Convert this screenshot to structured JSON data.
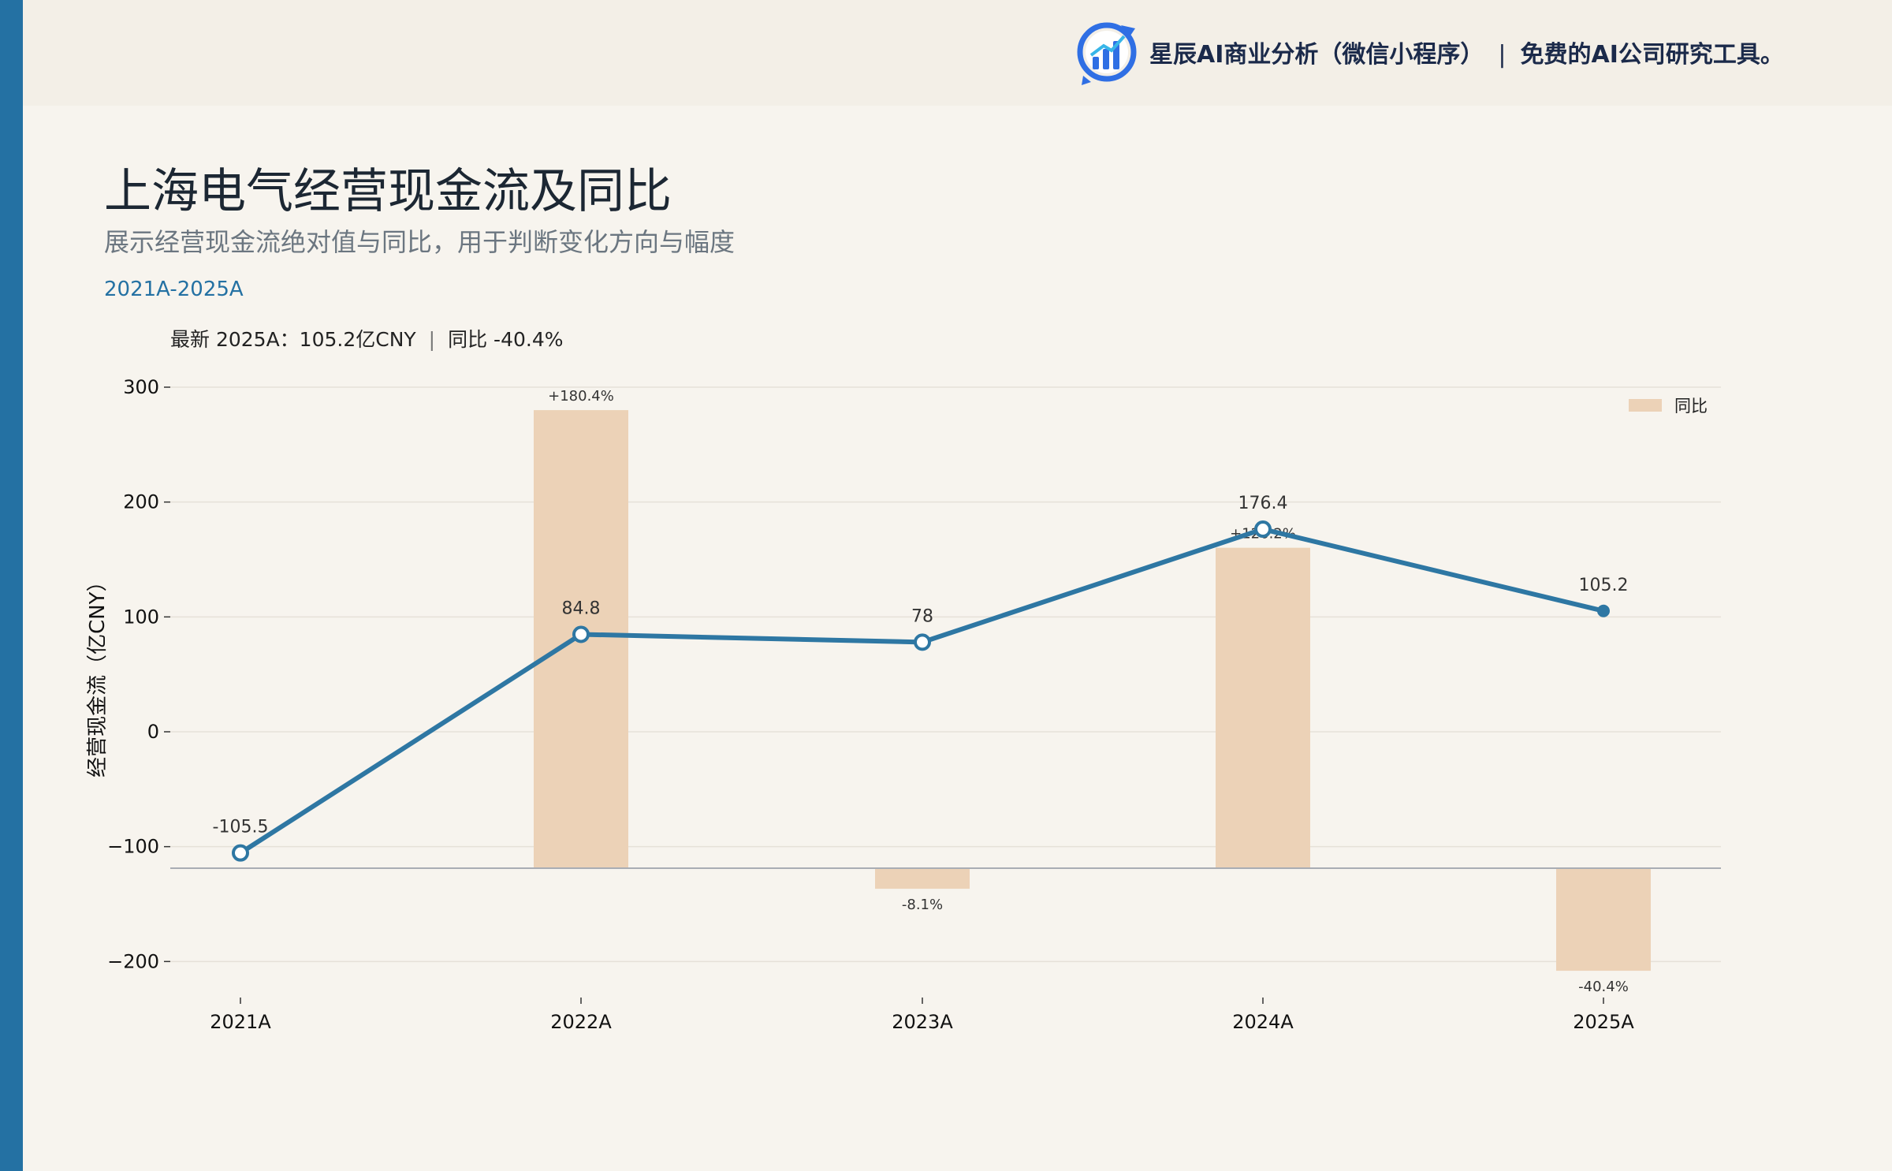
{
  "header": {
    "brand_name": "星辰AI商业分析（微信小程序）",
    "brand_separator": "|",
    "brand_tagline": "免费的AI公司研究工具。",
    "logo_icon": "bar-chart-logo-icon"
  },
  "title": "上海电气经营现金流及同比",
  "subtitle": "展示经营现金流绝对值与同比，用于判断变化方向与幅度",
  "period": "2021A-2025A",
  "kpi": {
    "latest": "最新 2025A：105.2亿CNY",
    "separator": "|",
    "yoy": "同比 -40.4%"
  },
  "colors": {
    "accent": "#2471a3",
    "line": "#2e77a3",
    "bar": "#ecd2b7",
    "background": "#f7f4ee"
  },
  "chart_data": {
    "type": "line+bar",
    "categories": [
      "2021A",
      "2022A",
      "2023A",
      "2024A",
      "2025A"
    ],
    "series": [
      {
        "name": "经营现金流",
        "type": "line",
        "values": [
          -105.5,
          84.8,
          78,
          176.4,
          105.2
        ],
        "labels": [
          "-105.5",
          "84.8",
          "78",
          "176.4",
          "105.2"
        ]
      },
      {
        "name": "同比",
        "type": "bar",
        "values": [
          null,
          180.4,
          -8.1,
          126.2,
          -40.4
        ],
        "labels": [
          "",
          "+180.4%",
          "-8.1%",
          "+126.2%",
          "-40.4%"
        ]
      }
    ],
    "ylabel": "经营现金流（亿CNY）",
    "ylim": [
      -230,
      310
    ],
    "yticks": [
      300,
      200,
      100,
      0,
      -100,
      -200
    ],
    "ytick_labels": [
      "300",
      "200",
      "100",
      "0",
      "−100",
      "−200"
    ],
    "grid": true,
    "legend": {
      "position": "top-right",
      "entries": [
        "同比"
      ]
    }
  }
}
